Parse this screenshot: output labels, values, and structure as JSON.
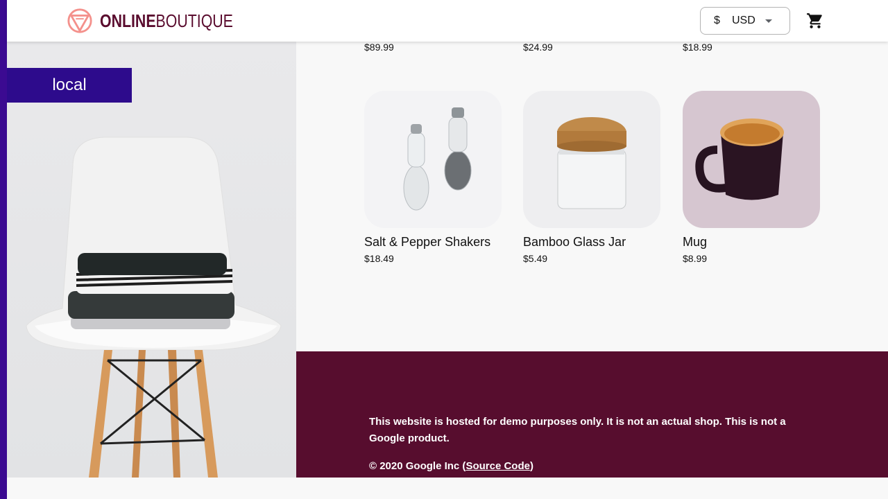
{
  "header": {
    "logo_bold": "ONLINE",
    "logo_light": "BOUTIQUE",
    "currency": {
      "symbol": "$",
      "code": "USD"
    },
    "cart_icon": "cart-icon"
  },
  "environment_badge": "local",
  "top_row_prices": [
    "$89.99",
    "$24.99",
    "$18.99"
  ],
  "products": [
    {
      "name": "Salt & Pepper Shakers",
      "price": "$18.49"
    },
    {
      "name": "Bamboo Glass Jar",
      "price": "$5.49"
    },
    {
      "name": "Mug",
      "price": "$8.99"
    }
  ],
  "footer": {
    "disclaimer": "This website is hosted for demo purposes only. It is not an actual shop. This is not a Google product.",
    "copyright_prefix": "© 2020 Google Inc (",
    "source_link": "Source Code",
    "copyright_suffix": ")"
  },
  "colors": {
    "brand": "#570d2e",
    "badge": "#2d0b8c",
    "left_bar": "#3b0a91"
  }
}
